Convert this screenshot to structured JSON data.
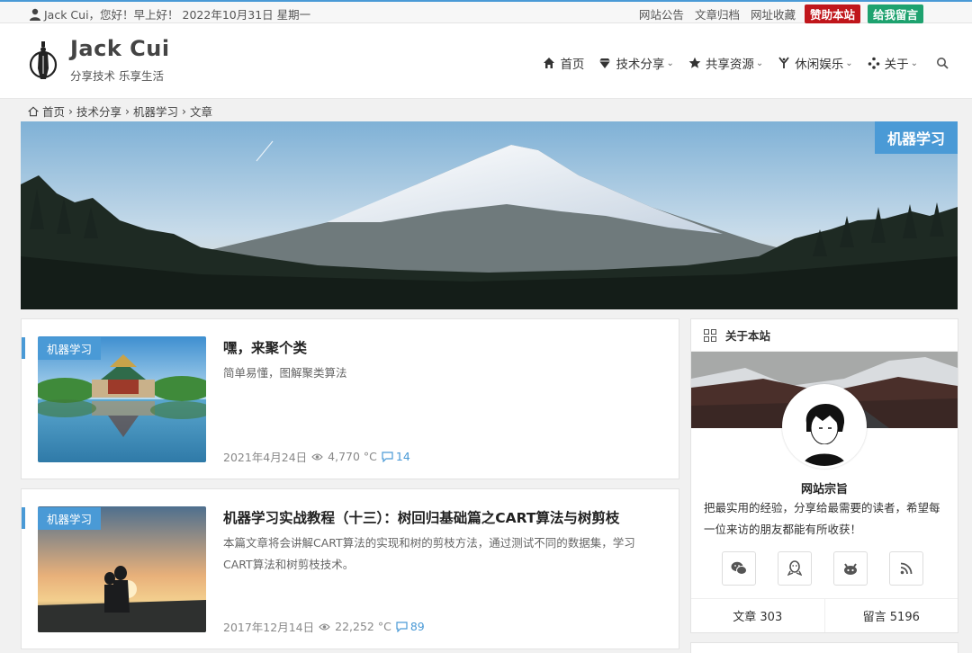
{
  "topbar": {
    "greeting": "Jack Cui，您好！早上好！ 2022年10月31日 星期一",
    "links": [
      "网站公告",
      "文章归档",
      "网址收藏"
    ],
    "donate": "赞助本站",
    "message": "给我留言"
  },
  "header": {
    "title": "Jack Cui",
    "subtitle": "分享技术 乐享生活"
  },
  "nav": [
    {
      "label": "首页",
      "icon": "home-icon"
    },
    {
      "label": "技术分享",
      "icon": "diamond-icon"
    },
    {
      "label": "共享资源",
      "icon": "star-icon"
    },
    {
      "label": "休闲娱乐",
      "icon": "fork-icon"
    },
    {
      "label": "关于",
      "icon": "dots-icon"
    }
  ],
  "breadcrumb": [
    "首页",
    "技术分享",
    "机器学习",
    "文章"
  ],
  "banner": {
    "tag": "机器学习"
  },
  "posts": [
    {
      "tag": "机器学习",
      "title": "嘿，来聚个类",
      "excerpt": "简单易懂，图解聚类算法",
      "date": "2021年4月24日",
      "views": "4,770 °C",
      "comments": "14"
    },
    {
      "tag": "机器学习",
      "title": "机器学习实战教程（十三）：树回归基础篇之CART算法与树剪枝",
      "excerpt": "本篇文章将会讲解CART算法的实现和树的剪枝方法，通过测试不同的数据集，学习CART算法和树剪枝技术。",
      "date": "2017年12月14日",
      "views": "22,252 °C",
      "comments": "89"
    }
  ],
  "sidebar": {
    "title": "关于本站",
    "motto_title": "网站宗旨",
    "motto": "把最实用的经验，分享给最需要的读者，希望每一位来访的朋友都能有所收获！",
    "articles": "文章 303",
    "messages": "留言 5196"
  },
  "colors": {
    "accent": "#4a9ad6",
    "donate": "#c0161b",
    "message": "#1ea26f"
  }
}
